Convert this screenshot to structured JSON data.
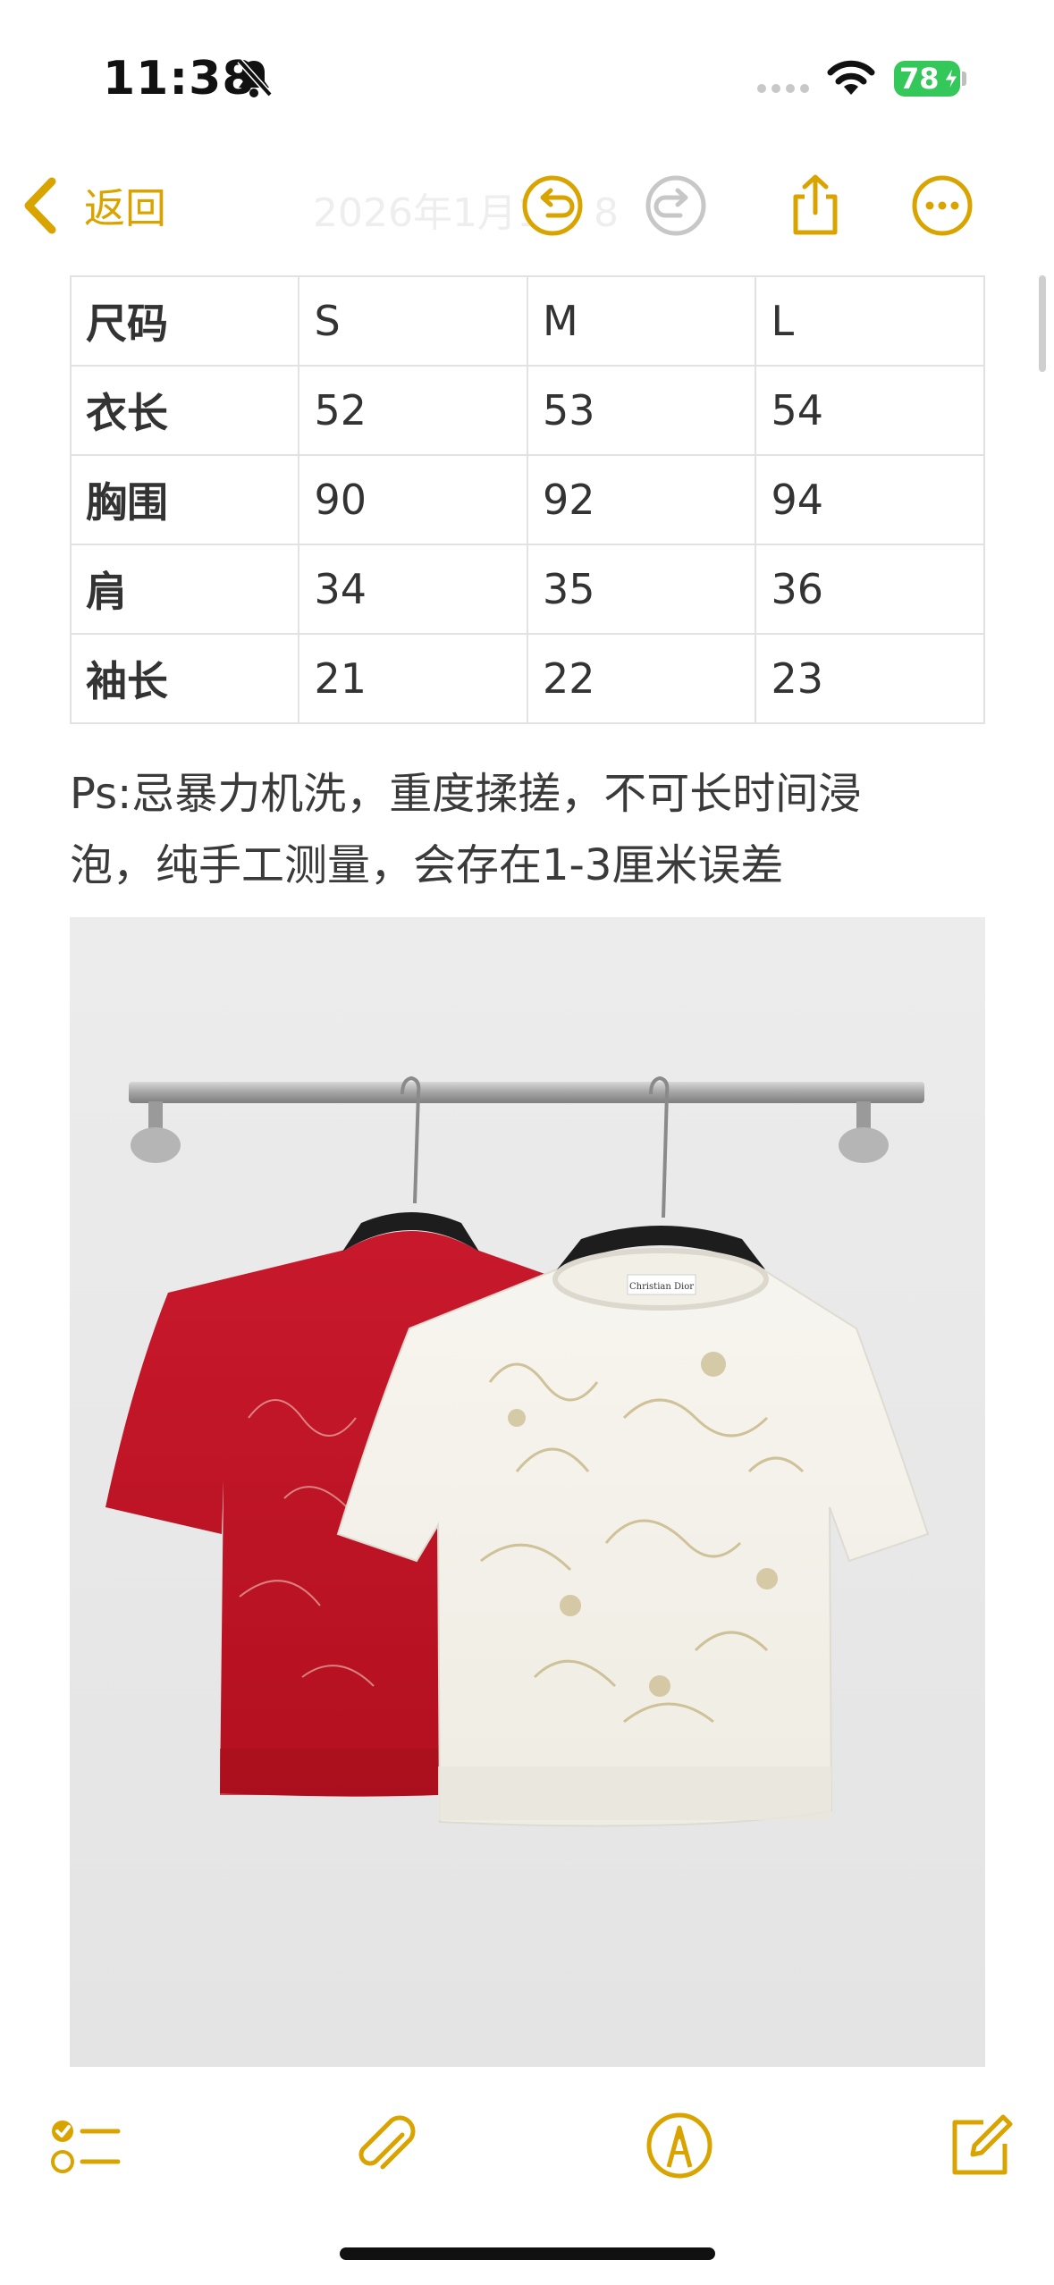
{
  "status_bar": {
    "time": "11:38",
    "battery_percent": "78",
    "icons": [
      "bell-slash-icon",
      "cellular-signal-icon",
      "wifi-icon",
      "battery-charging-icon"
    ]
  },
  "nav": {
    "back_label": "返回",
    "title": "2026年1月1日 8",
    "icons": [
      "chevron-left-icon",
      "undo-icon",
      "redo-icon",
      "share-icon",
      "more-icon"
    ]
  },
  "colors": {
    "accent": "#d9a400",
    "battery": "#34c759",
    "disabled": "#c7c7c7"
  },
  "size_table": {
    "rows": [
      [
        "尺码",
        "S",
        "M",
        "L"
      ],
      [
        "衣长",
        "52",
        "53",
        "54"
      ],
      [
        "胸围",
        "90",
        "92",
        "94"
      ],
      [
        "肩",
        "34",
        "35",
        "36"
      ],
      [
        "袖长",
        "21",
        "22",
        "23"
      ]
    ]
  },
  "note": {
    "line1": "Ps:忌暴力机洗，重度揉搓，不可长时间浸",
    "line2": "泡，纯手工测量，会存在1-3厘米误差"
  },
  "photo": {
    "label_text": "Christian Dior"
  },
  "toolbar": {
    "icons": [
      "checklist-icon",
      "paperclip-icon",
      "markup-pen-icon",
      "compose-icon"
    ]
  }
}
